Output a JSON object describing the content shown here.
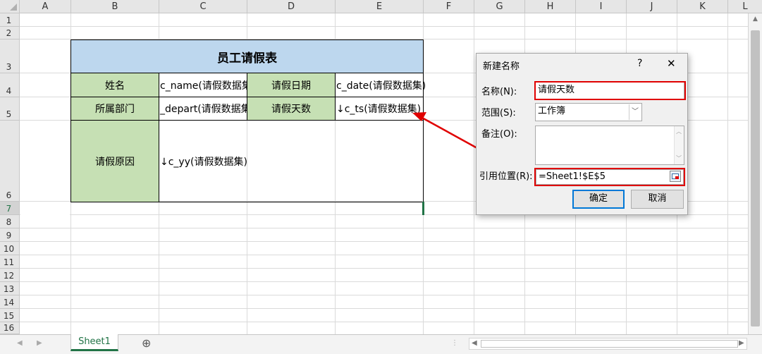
{
  "columns": [
    "A",
    "B",
    "C",
    "D",
    "E",
    "F",
    "G",
    "H",
    "I",
    "J",
    "K",
    "L"
  ],
  "rows": [
    "1",
    "2",
    "3",
    "4",
    "5",
    "6",
    "7",
    "8",
    "9",
    "10",
    "11",
    "12",
    "13",
    "14",
    "15",
    "16"
  ],
  "table": {
    "title": "员工请假表",
    "name_label": "姓名",
    "name_value": "c_name(请假数据集",
    "date_label": "请假日期",
    "date_value": "c_date(请假数据集)",
    "dept_label": "所属部门",
    "dept_value": "_depart(请假数据集",
    "days_label": "请假天数",
    "days_value": "↓c_ts(请假数据集)",
    "reason_label": "请假原因",
    "reason_value": "↓c_yy(请假数据集)"
  },
  "dialog": {
    "title": "新建名称",
    "help": "?",
    "close": "✕",
    "name_label": "名称(N):",
    "name_value": "请假天数",
    "scope_label": "范围(S):",
    "scope_value": "工作簿",
    "comment_label": "备注(O):",
    "comment_value": "",
    "ref_label": "引用位置(R):",
    "ref_value": "=Sheet1!$E$5",
    "ok": "确定",
    "cancel": "取消"
  },
  "sheet_tab": "Sheet1",
  "add_sheet": "⊕",
  "colors": {
    "accent": "#217346",
    "green_cell": "#c6e0b4",
    "blue_cell": "#bdd7ee",
    "highlight": "#e00000"
  }
}
